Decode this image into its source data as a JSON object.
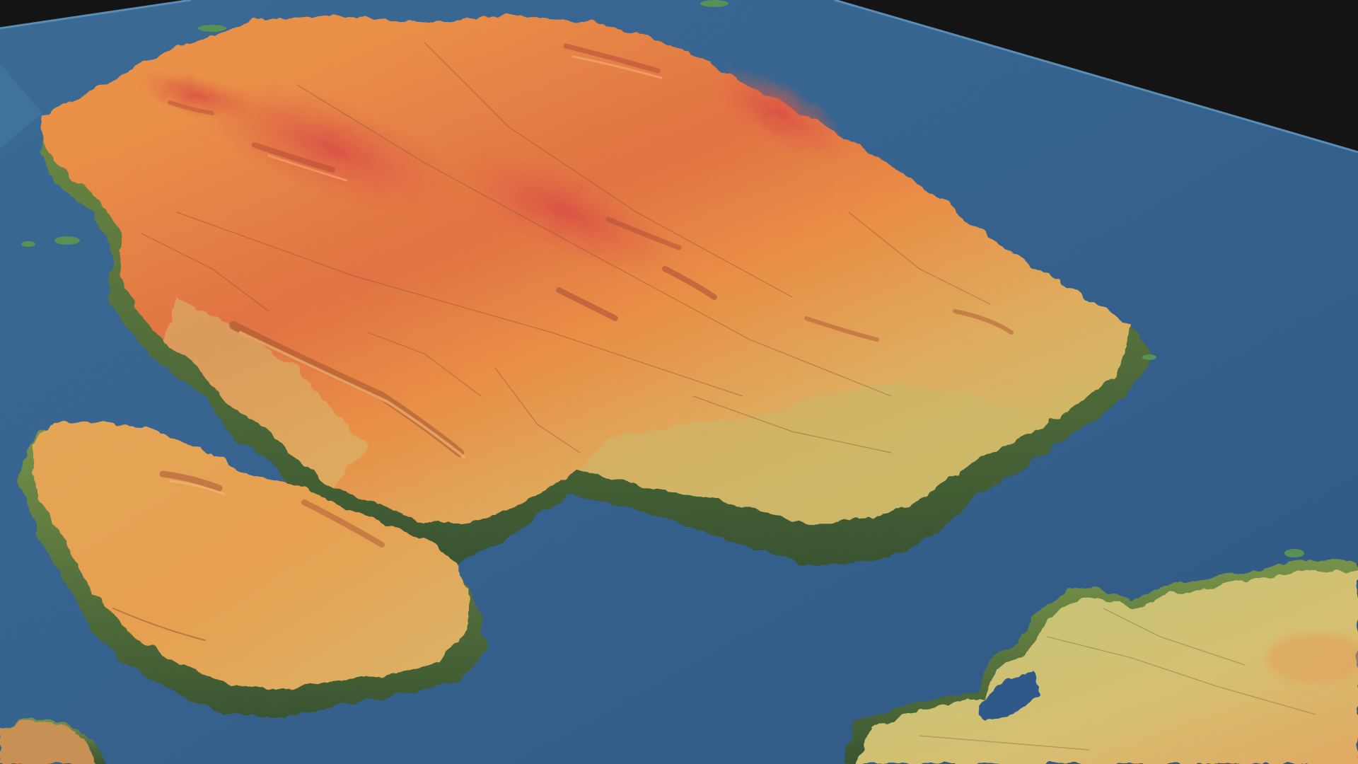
{
  "scene": {
    "view": "3d-oblique-terrain-relief",
    "colors": {
      "background": "#000000",
      "water_deep": "#1b4a7e",
      "water_shallow": "#2d6896",
      "shelf_edge": "#3f7ea8",
      "lowland": "#4e7e3a",
      "coast_green": "#8fb05a",
      "mid": "#d9b35e",
      "upland": "#e6923a",
      "summit": "#d8493a"
    },
    "landmasses": [
      {
        "name": "main-landmass",
        "relative_height": 0.9
      },
      {
        "name": "southwest-landmass",
        "relative_height": 0.6
      },
      {
        "name": "southeast-landmass",
        "relative_height": 0.35
      },
      {
        "name": "small-islet-southwest",
        "relative_height": 0.4
      }
    ]
  }
}
